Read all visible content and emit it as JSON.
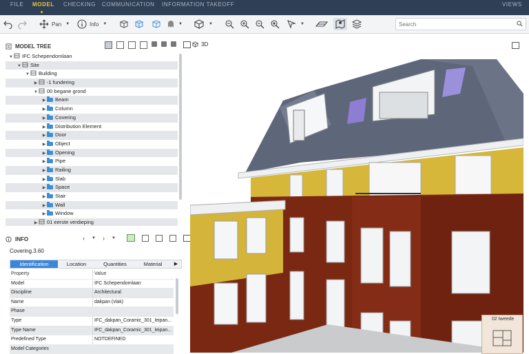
{
  "menu": {
    "items": [
      "FILE",
      "MODEL",
      "CHECKING",
      "COMMUNICATION",
      "INFORMATION TAKEOFF"
    ],
    "active": "MODEL",
    "right": "VIEWS"
  },
  "toolbar": {
    "pan_label": "Pan",
    "info_label": "Info",
    "search_placeholder": "Search"
  },
  "model_tree": {
    "title": "MODEL TREE",
    "rows": [
      {
        "label": "IFC Schependomlaan",
        "indent": 0,
        "expanded": true,
        "icon": "project-icon"
      },
      {
        "label": "Site",
        "indent": 1,
        "expanded": true,
        "icon": "site-icon"
      },
      {
        "label": "Building",
        "indent": 2,
        "expanded": true,
        "icon": "building-icon"
      },
      {
        "label": "-1 fundering",
        "indent": 3,
        "expanded": false,
        "icon": "storey-icon"
      },
      {
        "label": "00 begane grond",
        "indent": 3,
        "expanded": true,
        "icon": "storey-icon"
      },
      {
        "label": "Beam",
        "indent": 4,
        "expanded": false,
        "icon": "folder-icon"
      },
      {
        "label": "Column",
        "indent": 4,
        "expanded": false,
        "icon": "folder-icon"
      },
      {
        "label": "Covering",
        "indent": 4,
        "expanded": false,
        "icon": "folder-icon"
      },
      {
        "label": "Distribution Element",
        "indent": 4,
        "expanded": false,
        "icon": "folder-icon"
      },
      {
        "label": "Door",
        "indent": 4,
        "expanded": false,
        "icon": "folder-icon"
      },
      {
        "label": "Object",
        "indent": 4,
        "expanded": false,
        "icon": "folder-icon"
      },
      {
        "label": "Opening",
        "indent": 4,
        "expanded": false,
        "icon": "folder-icon"
      },
      {
        "label": "Pipe",
        "indent": 4,
        "expanded": false,
        "icon": "folder-icon"
      },
      {
        "label": "Railing",
        "indent": 4,
        "expanded": false,
        "icon": "folder-icon"
      },
      {
        "label": "Slab",
        "indent": 4,
        "expanded": false,
        "icon": "folder-icon"
      },
      {
        "label": "Space",
        "indent": 4,
        "expanded": false,
        "icon": "folder-icon"
      },
      {
        "label": "Stair",
        "indent": 4,
        "expanded": false,
        "icon": "folder-icon"
      },
      {
        "label": "Wall",
        "indent": 4,
        "expanded": false,
        "icon": "folder-icon"
      },
      {
        "label": "Window",
        "indent": 4,
        "expanded": false,
        "icon": "folder-icon"
      },
      {
        "label": "01 eerste verdieping",
        "indent": 3,
        "expanded": false,
        "icon": "storey-icon"
      }
    ]
  },
  "info": {
    "title": "INFO",
    "selected": "Covering.3.60",
    "tabs": [
      "Identification",
      "Location",
      "Quantities",
      "Material"
    ],
    "active_tab": "Identification",
    "columns": [
      "Property",
      "Value"
    ],
    "rows": [
      [
        "Model",
        "IFC Schependomlaan"
      ],
      [
        "Discipline",
        "Architectural"
      ],
      [
        "Name",
        "dakpan (vlak)"
      ],
      [
        "Phase",
        ""
      ],
      [
        "Type",
        "IFC_dakpan_Coramic_301_leipan..."
      ],
      [
        "Type Name",
        "IFC_dakpan_Coramic_301_leipan..."
      ],
      [
        "Predefined Type",
        "NOTDEFINED"
      ],
      [
        "Model Categories",
        ""
      ]
    ]
  },
  "view3d": {
    "title": "3D",
    "storey_label": "02 tweede"
  },
  "colors": {
    "menubar": "#2f3f55",
    "accent": "#f0c23c",
    "selection": "#3a86d8",
    "brick": "#7a2812",
    "render": "#d8b93a",
    "roof": "#5d6577"
  }
}
